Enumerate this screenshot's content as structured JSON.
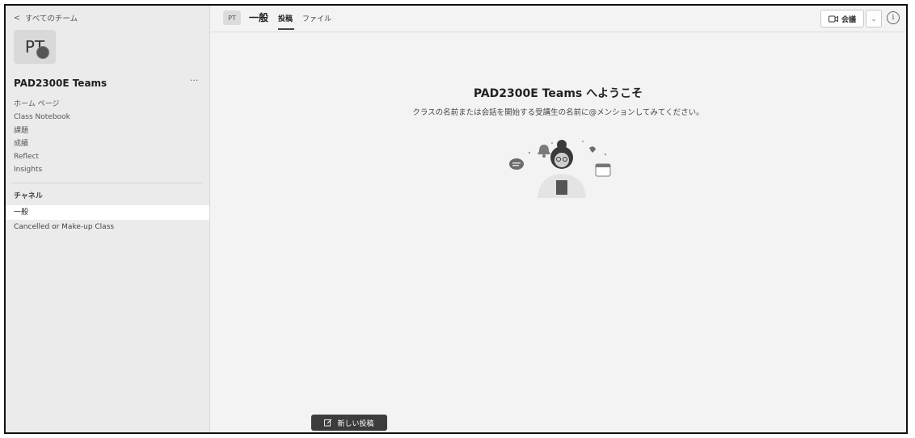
{
  "sidebar": {
    "back_label": "すべてのチーム",
    "avatar_initials": "PT",
    "team_name": "PAD2300E Teams",
    "more_label": "···",
    "nav_items": [
      {
        "label": "ホーム ページ"
      },
      {
        "label": "Class Notebook"
      },
      {
        "label": "課題"
      },
      {
        "label": "成績"
      },
      {
        "label": "Reflect"
      },
      {
        "label": "Insights"
      }
    ],
    "channels_label": "チャネル",
    "channels": [
      {
        "label": "一般",
        "active": true
      },
      {
        "label": "Cancelled or Make-up Class",
        "active": false
      }
    ]
  },
  "header": {
    "chip": "PT",
    "channel_title": "一般",
    "tabs": [
      {
        "label": "投稿",
        "active": true
      },
      {
        "label": "ファイル",
        "active": false
      }
    ],
    "meet_label": "会議"
  },
  "main": {
    "welcome_title": "PAD2300E Teams へようこそ",
    "welcome_subtitle": "クラスの名前または会話を開始する受講生の名前に@メンションしてみてください。",
    "new_post_label": "新しい投稿"
  }
}
